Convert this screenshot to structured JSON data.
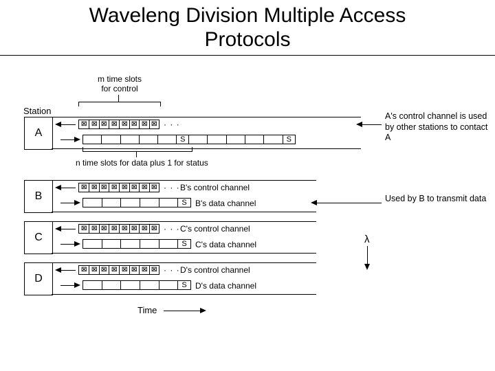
{
  "title_line1": "Waveleng Division Multiple Access",
  "title_line2": "Protocols",
  "labels": {
    "m_slots": "m time slots",
    "for_control": "for control",
    "station": "Station",
    "n_slots": "n time slots for data plus 1 for status",
    "time": "Time",
    "lambda": "λ"
  },
  "stations": {
    "A": "A",
    "B": "B",
    "C": "C",
    "D": "D"
  },
  "channels": {
    "b_ctrl": "B's control channel",
    "b_data": "B's data channel",
    "c_ctrl": "C's control channel",
    "c_data": "C's data channel",
    "d_ctrl": "D's control channel",
    "d_data": "D's data channel"
  },
  "s": "S",
  "annotations": {
    "a_ctrl": "A's control channel is used by other stations to contact A",
    "b_use": "Used by B to transmit data"
  },
  "ellipsis": "· · ·",
  "chart_data": {
    "type": "table",
    "title": "WDMA channel/timeslot layout",
    "stations": [
      "A",
      "B",
      "C",
      "D"
    ],
    "control_slots_m": 8,
    "data_slots_n_plus_status": "n+1",
    "rows": [
      {
        "station": "A",
        "control_channel_dir": "in",
        "data_channel_dir": "out",
        "data_row_status_visible_slots": [
          "S",
          "S"
        ]
      },
      {
        "station": "B",
        "control_channel_dir": "in",
        "data_channel_dir": "out",
        "data_row_status_visible_slots": [
          "S"
        ]
      },
      {
        "station": "C",
        "control_channel_dir": "in",
        "data_channel_dir": "out",
        "data_row_status_visible_slots": [
          "S"
        ]
      },
      {
        "station": "D",
        "control_channel_dir": "in",
        "data_channel_dir": "out",
        "data_row_status_visible_slots": [
          "S"
        ]
      }
    ],
    "x_axis": "Time",
    "y_axis": "λ (wavelength)",
    "notes": {
      "A_control": "A's control channel is used by other stations to contact A",
      "B_data": "Used by B to transmit data"
    }
  }
}
